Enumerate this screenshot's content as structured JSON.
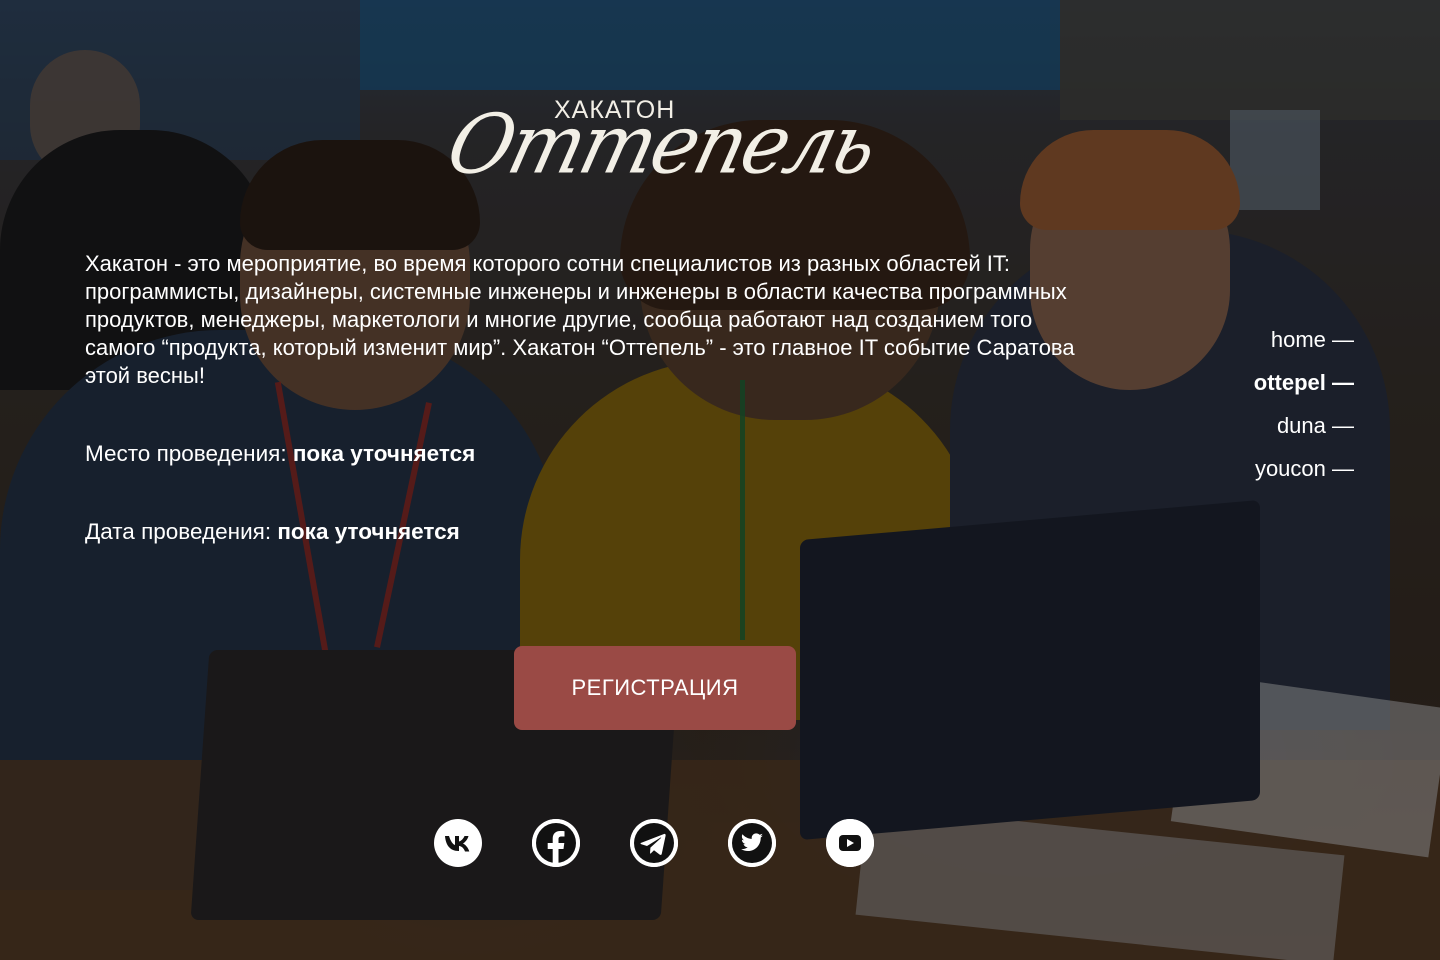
{
  "logo": {
    "small_text": "ХАКАТОН",
    "script_text": "Оттепель"
  },
  "description": "Хакатон - это мероприятие, во время которого сотни специалистов из разных областей IT: программисты, дизайнеры, системные инженеры и инженеры в области качества программных продуктов, менеджеры, маркетологи и многие другие, сообща работают над созданием того самого “продукта, который изменит мир”. Хакатон “Оттепель” - это главное IT событие Саратова этой весны!",
  "place": {
    "label": "Место проведения:",
    "value": "пока уточняется"
  },
  "date": {
    "label": "Дата проведения:",
    "value": "пока уточняется"
  },
  "nav": {
    "items": [
      {
        "label": "home —",
        "active": false
      },
      {
        "label": "ottepel —",
        "active": true
      },
      {
        "label": "duna —",
        "active": false
      },
      {
        "label": "youcon —",
        "active": false
      }
    ]
  },
  "register_label": "РЕГИСТРАЦИЯ",
  "social": [
    {
      "icon": "vk-icon"
    },
    {
      "icon": "facebook-icon"
    },
    {
      "icon": "telegram-icon"
    },
    {
      "icon": "twitter-icon"
    },
    {
      "icon": "youtube-icon"
    }
  ],
  "colors": {
    "button": "#9a4a45",
    "text": "#ffffff",
    "logo": "#f2efe6"
  }
}
